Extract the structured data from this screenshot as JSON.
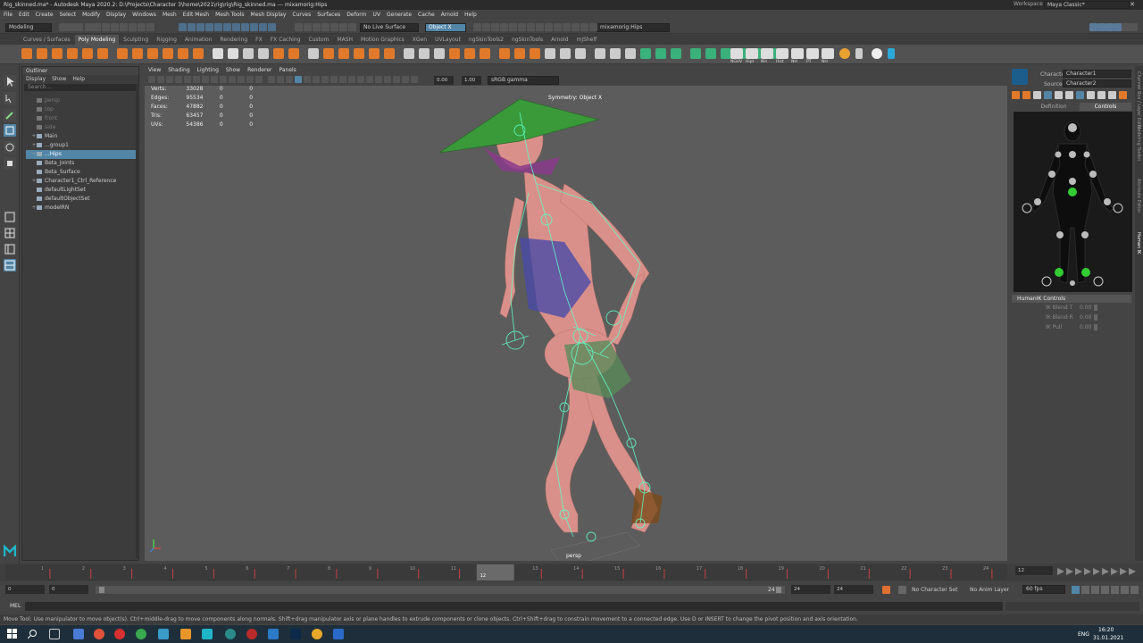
{
  "window": {
    "title": "Rig_skinned.ma* - Autodesk Maya 2020.2: D:\\Projects\\Character 3\\home\\2021\\rig\\rig\\Rig_skinned.ma  ---  mixamorig:Hips",
    "workspace_label": "Workspace :",
    "workspace_value": "Maya Classic*"
  },
  "menubar": [
    "File",
    "Edit",
    "Create",
    "Select",
    "Modify",
    "Display",
    "Windows",
    "Mesh",
    "Edit Mesh",
    "Mesh Tools",
    "Mesh Display",
    "Curves",
    "Surfaces",
    "Deform",
    "UV",
    "Generate",
    "Cache",
    "Arnold",
    "Help"
  ],
  "statusline": {
    "mode": "Modeling",
    "live_surface": "No Live Surface",
    "object_mode": "Object X",
    "selection_field": "mixamorig:Hips"
  },
  "shelf_tabs": [
    "Curves / Surfaces",
    "Poly Modeling",
    "Sculpting",
    "Rigging",
    "Animation",
    "Rendering",
    "FX",
    "FX Caching",
    "Custom",
    "MASH",
    "Motion Graphics",
    "XGen",
    "UVLayout",
    "ngSkinTools2",
    "ngSkinTools",
    "Arnold",
    "mjShelf"
  ],
  "active_shelf": "Poly Modeling",
  "shelf_icon_labels": [
    "NGUV",
    "Hipt",
    "NH",
    "Hist",
    "NH",
    "PT",
    "NH"
  ],
  "outliner": {
    "title": "Outliner",
    "menu": [
      "Display",
      "Show",
      "Help"
    ],
    "search_placeholder": "Search...",
    "items": [
      {
        "label": "persp",
        "dim": true,
        "indent": 1,
        "expand": ""
      },
      {
        "label": "top",
        "dim": true,
        "indent": 1,
        "expand": ""
      },
      {
        "label": "front",
        "dim": true,
        "indent": 1,
        "expand": ""
      },
      {
        "label": "side",
        "dim": true,
        "indent": 1,
        "expand": ""
      },
      {
        "label": "Main",
        "dim": false,
        "indent": 1,
        "expand": "+"
      },
      {
        "label": "...group1",
        "dim": false,
        "indent": 1,
        "expand": "+"
      },
      {
        "label": "...Hips",
        "dim": false,
        "indent": 1,
        "expand": "+",
        "selected": true
      },
      {
        "label": "Beta_Joints",
        "dim": false,
        "indent": 1,
        "expand": ""
      },
      {
        "label": "Beta_Surface",
        "dim": false,
        "indent": 1,
        "expand": ""
      },
      {
        "label": "Character1_Ctrl_Reference",
        "dim": false,
        "indent": 1,
        "expand": "+"
      },
      {
        "label": "defaultLightSet",
        "dim": false,
        "indent": 1,
        "expand": ""
      },
      {
        "label": "defaultObjectSet",
        "dim": false,
        "indent": 1,
        "expand": ""
      },
      {
        "label": "modelRN",
        "dim": false,
        "indent": 1,
        "expand": "+"
      }
    ]
  },
  "viewport": {
    "menu": [
      "View",
      "Shading",
      "Lighting",
      "Show",
      "Renderer",
      "Panels"
    ],
    "gamma": "sRGB gamma",
    "exposure": "0.00",
    "gamma_value": "1.00",
    "symmetry": "Symmetry: Object X",
    "camera_label": "persp",
    "hud": [
      {
        "name": "Verts:",
        "a": "33028",
        "b": "0",
        "c": "0"
      },
      {
        "name": "Edges:",
        "a": "95534",
        "b": "0",
        "c": "0"
      },
      {
        "name": "Faces:",
        "a": "47882",
        "b": "0",
        "c": "0"
      },
      {
        "name": "Tris:",
        "a": "63457",
        "b": "0",
        "c": "0"
      },
      {
        "name": "UVs:",
        "a": "54386",
        "b": "0",
        "c": "0"
      }
    ]
  },
  "humanik": {
    "character_label": "Character:",
    "character_value": "Character1",
    "source_label": "Source:",
    "source_value": "Character2",
    "tabs": [
      "Definition",
      "Controls"
    ],
    "active_tab": "Controls",
    "section": "HumanIK Controls",
    "sliders": [
      {
        "label": "IK Blend T",
        "value": "0.00"
      },
      {
        "label": "IK Blend R",
        "value": "0.00"
      },
      {
        "label": "IK Pull",
        "value": "0.00"
      }
    ]
  },
  "right_strip_tabs": [
    "Channel Box / Layer Editor",
    "Modeling Toolkit",
    "Attribute Editor",
    "Human IK"
  ],
  "timeline": {
    "ticks": [
      "1",
      "2",
      "3",
      "4",
      "5",
      "6",
      "7",
      "8",
      "9",
      "10",
      "11",
      "12",
      "13",
      "14",
      "15",
      "16",
      "17",
      "18",
      "19",
      "20",
      "21",
      "22",
      "23",
      "24"
    ],
    "current_frame_marker": "12",
    "current_frame_field": "12"
  },
  "range": {
    "start": "0",
    "anim_start": "0",
    "range_end_label": "24",
    "end": "24",
    "anim_end": "24",
    "no_character_set": "No Character Set",
    "no_anim_layer": "No Anim Layer",
    "fps": "60 fps"
  },
  "cmdline": {
    "label": "MEL"
  },
  "helpline": "Move Tool: Use manipulator to move object(s). Ctrl+middle-drag to move components along normals. Shift+drag manipulator axis or plane handles to extrude components or clone objects. Ctrl+Shift+drag to constrain movement to a connected edge. Use D or INSERT to change the pivot position and axis orientation.",
  "taskbar": {
    "lang": "ENG",
    "time": "16:20",
    "date": "31.01.2021"
  }
}
